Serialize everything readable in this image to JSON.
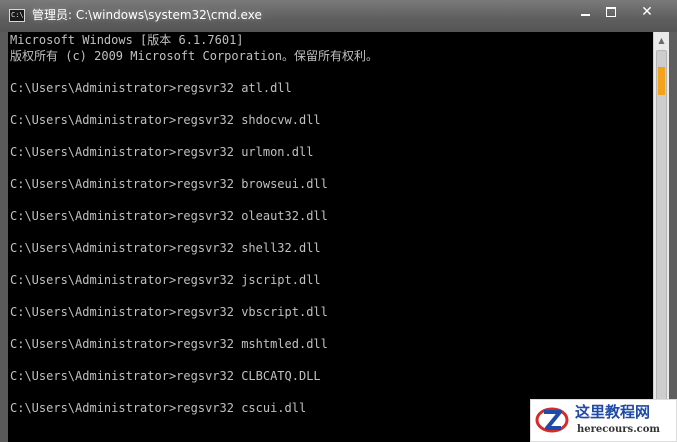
{
  "window": {
    "title": "管理员: C:\\windows\\system32\\cmd.exe",
    "icon": "console-app-icon",
    "icon_glyph": "C:\\"
  },
  "controls": {
    "minimize_icon": "minimize-icon",
    "maximize_icon": "maximize-icon",
    "close_icon": "close-icon",
    "close_glyph": "✕"
  },
  "console": {
    "colors": {
      "background": "#000000",
      "foreground": "#c0c0c0"
    },
    "lines": [
      "Microsoft Windows [版本 6.1.7601]",
      "版权所有 (c) 2009 Microsoft Corporation。保留所有权利。",
      "",
      "C:\\Users\\Administrator>regsvr32 atl.dll",
      "",
      "C:\\Users\\Administrator>regsvr32 shdocvw.dll",
      "",
      "C:\\Users\\Administrator>regsvr32 urlmon.dll",
      "",
      "C:\\Users\\Administrator>regsvr32 browseui.dll",
      "",
      "C:\\Users\\Administrator>regsvr32 oleaut32.dll",
      "",
      "C:\\Users\\Administrator>regsvr32 shell32.dll",
      "",
      "C:\\Users\\Administrator>regsvr32 jscript.dll",
      "",
      "C:\\Users\\Administrator>regsvr32 vbscript.dll",
      "",
      "C:\\Users\\Administrator>regsvr32 mshtmled.dll",
      "",
      "C:\\Users\\Administrator>regsvr32 CLBCATQ.DLL",
      "",
      "C:\\Users\\Administrator>regsvr32 cscui.dll"
    ]
  },
  "scrollbar": {
    "up_arrow_icon": "scroll-up-arrow-icon",
    "up_glyph": "▲",
    "thumb_accent": "#f3a21c"
  },
  "watermark": {
    "title": "这里教程网",
    "url": "herecours.com",
    "logo_colors": {
      "ring": "#d42b2b",
      "letter": "#1f4aa8"
    }
  }
}
